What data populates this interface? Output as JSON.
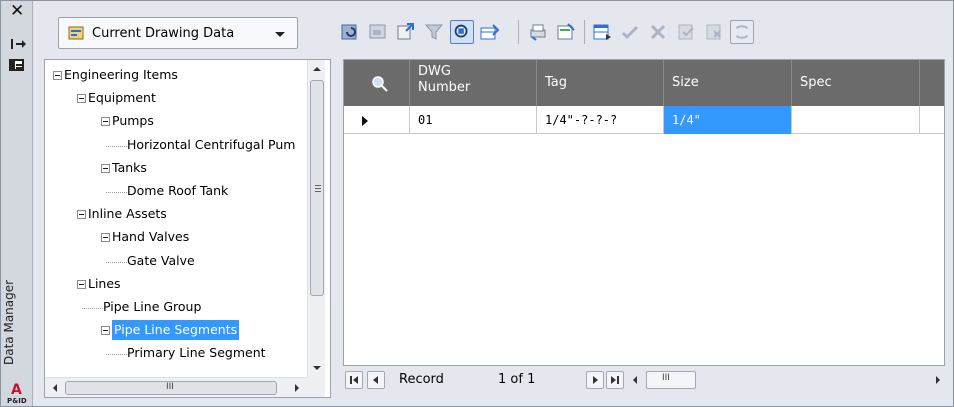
{
  "panel": {
    "title": "Data Manager",
    "logo_text": "P&ID"
  },
  "data_source": {
    "selected": "Current Drawing Data"
  },
  "tree": {
    "items": [
      {
        "label": "Engineering Items",
        "depth": 0,
        "expandable": true
      },
      {
        "label": "Equipment",
        "depth": 1,
        "expandable": true
      },
      {
        "label": "Pumps",
        "depth": 2,
        "expandable": true
      },
      {
        "label": "Horizontal Centrifugal Pum",
        "depth": 3,
        "expandable": false
      },
      {
        "label": "Tanks",
        "depth": 2,
        "expandable": true
      },
      {
        "label": "Dome Roof Tank",
        "depth": 3,
        "expandable": false
      },
      {
        "label": "Inline Assets",
        "depth": 1,
        "expandable": true
      },
      {
        "label": "Hand Valves",
        "depth": 2,
        "expandable": true
      },
      {
        "label": "Gate Valve",
        "depth": 3,
        "expandable": false
      },
      {
        "label": "Lines",
        "depth": 1,
        "expandable": true
      },
      {
        "label": "Pipe Line Group",
        "depth": 2,
        "expandable": false
      },
      {
        "label": "Pipe Line Segments",
        "depth": 2,
        "expandable": true,
        "selected": true
      },
      {
        "label": "Primary Line Segment",
        "depth": 3,
        "expandable": false
      }
    ],
    "hscroll_grip": "III"
  },
  "grid": {
    "columns": [
      "DWG\nNumber",
      "Tag",
      "Size",
      "Spec"
    ],
    "rows": [
      {
        "dwg_number": "01",
        "tag": "1/4\"-?-?-?",
        "size": "1/4\"",
        "spec": ""
      }
    ],
    "highlight_color": "#3399ff",
    "header_color": "#6b6b6b"
  },
  "navigator": {
    "label": "Record",
    "count": "1 of 1",
    "hscroll_grip": "III"
  }
}
